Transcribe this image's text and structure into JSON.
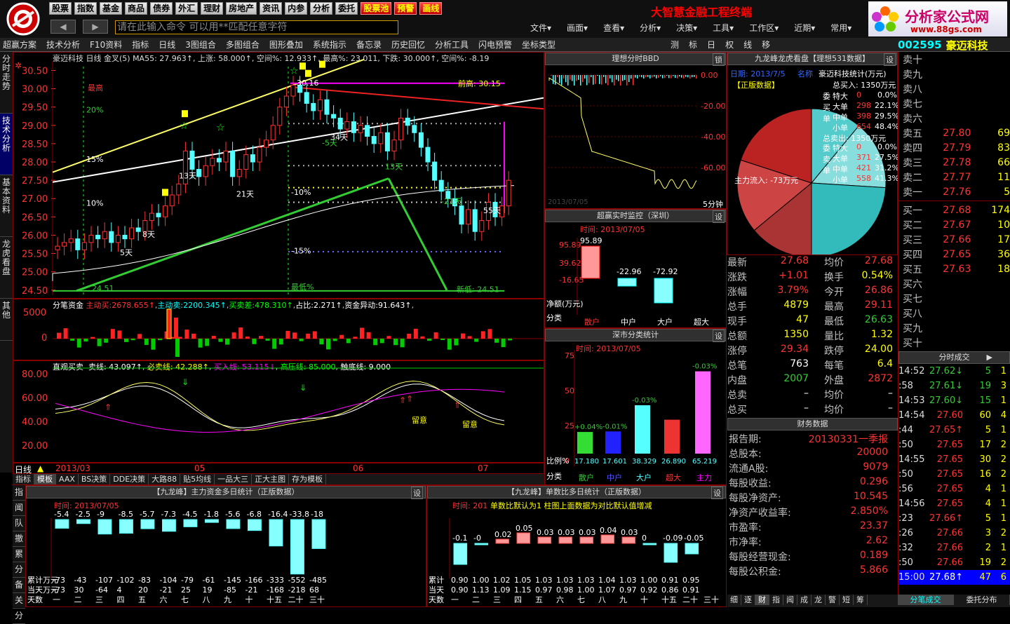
{
  "menubar": {
    "buttons": [
      "股票",
      "指数",
      "基金",
      "商品",
      "债券",
      "外汇",
      "理财",
      "房地产",
      "资讯",
      "内参",
      "分析",
      "委托"
    ],
    "red_buttons": [
      "股票池",
      "预警",
      "画线"
    ],
    "title": "大智慧金融工程终端",
    "cmd_placeholder": "请在此输入命令   可以用**匹配任意字符",
    "menus": [
      "文件▾",
      "画面▾",
      "查看▾",
      "分析▾",
      "决策▾",
      "工具▾",
      "工作区▾",
      "近期▾",
      "常用▾"
    ],
    "brand_name": "分析家公式网",
    "brand_url": "www.88gs.com"
  },
  "toolbar": [
    "超赢方案",
    "技术分析",
    "F10资料",
    "指标",
    "日线",
    "3图组合",
    "多图组合",
    "图形叠加",
    "系统指示",
    "备忘录",
    "历史回忆",
    "分析工具",
    "闪电预警",
    "坐标类型",
    "测",
    "标",
    "日",
    "权",
    "线",
    "移"
  ],
  "stock": {
    "code": "002595",
    "name": "豪迈科技"
  },
  "left_tabs": [
    "分时走势",
    "技术分析",
    "基本资料",
    "龙虎看盘",
    "其他"
  ],
  "main_info": "豪迈科技 日线 金叉(5) MA55: 27.963↑, 上涨: 58.000↑, 空间%: 12.933↑, 最高%: 23.011, 下跌: 30.000↑, 空间%: -8.19",
  "price_axis": [
    "30.50",
    "30.00",
    "29.50",
    "29.00",
    "28.50",
    "28.00",
    "27.50",
    "27.00",
    "26.50",
    "26.00",
    "25.50",
    "25.00",
    "24.50"
  ],
  "chart_labels": {
    "high": "最高",
    "high_price": "30.16",
    "prev_high": "前高: 30.15",
    "new_low": "新低: 24.51",
    "low_pct": "最低%",
    "low_price": "24.51",
    "pct_20": "20%",
    "pct_15": "15%",
    "pct_10": "10%",
    "pct_m10": "-10%",
    "pct_m15": "-15%",
    "d5": "5天",
    "d8": "8天",
    "d13": "13天",
    "d21": "21天",
    "d34": "34天",
    "d55": "55天",
    "dm5": "-5天",
    "dm21": "-21天",
    "d13b": "13天"
  },
  "sub1": {
    "title": "分笔资金",
    "zd_label": "主动买:",
    "zd": "2678.655↑",
    "zm_label": "主动卖:",
    "zm": "2200.345↑",
    "mc_label": "买卖差:",
    "mc": "478.310↑",
    "zb_label": "占比:",
    "zb": "2.271↑",
    "zj_label": "资金异动:",
    "zj": "91.643↑",
    "axis": [
      "5000",
      "0"
    ]
  },
  "sub2": {
    "title": "直观买卖",
    "m1": "卖线: 43.097↑",
    "m2": "必卖线: 42.288↑",
    "m3": "买入线: 53.115↓",
    "m4": "高压线: 85.000",
    "m5": "触底线: 9.000",
    "axis": [
      "80.00",
      "60.00",
      "40.00",
      "20.00"
    ],
    "note1": "留意",
    "note2": "留意"
  },
  "date_axis": {
    "period": "日线",
    "dates": [
      "2013/03",
      "05",
      "06",
      "07"
    ]
  },
  "bottom_tabs": [
    "指标",
    "模板",
    "AAX",
    "BS决策",
    "DDE决策",
    "大路88",
    "贴5均线",
    "一品大三",
    "正大主图",
    "存为模板"
  ],
  "bbd": {
    "title": "理想分时BBD",
    "lock": "锁",
    "axis": [
      "0.00",
      "-20.00",
      "-40.00",
      "-60.00"
    ],
    "date": "2013/07/05",
    "period": "5分钟"
  },
  "monitor": {
    "title": "超赢实时监控（深圳）",
    "set": "设",
    "time": "时间: 2013/07/05",
    "axis": [
      "95.89",
      "39.62",
      "-16.65"
    ],
    "vals": [
      "95.89",
      "-22.96",
      "-72.92"
    ],
    "unit": "净额(万元)",
    "cat_label": "分类",
    "cats": [
      "散户",
      "中户",
      "大户",
      "超大"
    ]
  },
  "classify": {
    "title": "深市分类统计",
    "set": "设",
    "time": "时间: 2013/07/05",
    "axis": [
      "75",
      "50",
      "25",
      "0"
    ],
    "top": [
      "+0.04%",
      "-0.01%",
      "-0.03%",
      "-0.03%"
    ],
    "vals": [
      "17.180",
      "17.601",
      "38.329",
      "26.890",
      "65.219"
    ],
    "unit": "比例%",
    "cat_label": "分类",
    "cats": [
      "散户",
      "中户",
      "大户",
      "超大",
      "主力"
    ]
  },
  "dragon": {
    "title": "九龙峰龙虎看盘【理想531数据】",
    "set": "设",
    "date": "日期: 2013/7/5",
    "name_label": "名称",
    "stat": "豪迈科技统计(万元)",
    "edition": "【正版数据】",
    "buy_total": "总买入: 1350万元",
    "sell_total": "总卖出: 1350万元",
    "net": "主力流入: -73万元",
    "buy_rows": [
      {
        "n": "特大",
        "v": "0",
        "p": "0.0%"
      },
      {
        "n": "大单",
        "v": "298",
        "p": "22.1%"
      },
      {
        "n": "中单",
        "v": "398",
        "p": "29.5%"
      },
      {
        "n": "小单",
        "v": "654",
        "p": "48.4%"
      }
    ],
    "sell_rows": [
      {
        "n": "特大",
        "v": "0",
        "p": "0.0%"
      },
      {
        "n": "大单",
        "v": "371",
        "p": "27.5%"
      },
      {
        "n": "中单",
        "v": "421",
        "p": "31.2%"
      },
      {
        "n": "小单",
        "v": "558",
        "p": "41.3%"
      }
    ],
    "side_buy": [
      "委",
      "买",
      "单"
    ],
    "side_sell": [
      "委",
      "卖",
      "单"
    ]
  },
  "info": [
    [
      "最新",
      "27.68",
      "均价",
      "27.68"
    ],
    [
      "涨跌",
      "+1.01",
      "换手",
      "0.54%"
    ],
    [
      "涨幅",
      "3.79%",
      "今开",
      "26.86"
    ],
    [
      "总手",
      "4879",
      "最高",
      "29.11"
    ],
    [
      "现手",
      "47",
      "最低",
      "26.63"
    ],
    [
      "总额",
      "1350",
      "量比",
      "1.32"
    ],
    [
      "涨停",
      "29.34",
      "跌停",
      "24.00"
    ],
    [
      "总笔",
      "763",
      "每笔",
      "6.4"
    ],
    [
      "内盘",
      "2007",
      "外盘",
      "2872"
    ],
    [
      "总卖",
      "–",
      "均价",
      "–"
    ],
    [
      "总买",
      "–",
      "均价",
      "–"
    ]
  ],
  "finance": {
    "title": "财务数据",
    "rows": [
      [
        "报告期:",
        "20130331一季报"
      ],
      [
        "总股本:",
        "20000"
      ],
      [
        "流通A股:",
        "9079"
      ],
      [
        "每股收益:",
        "0.296"
      ],
      [
        "每股净资产:",
        "10.545"
      ],
      [
        "净资产收益率:",
        "2.850%"
      ],
      [
        "市盈率:",
        "23.37"
      ],
      [
        "市净率:",
        "2.62"
      ],
      [
        "每股经营现金:",
        "0.189"
      ],
      [
        "每股公积金:",
        "5.866"
      ]
    ]
  },
  "quote": {
    "sell": [
      [
        "卖十",
        "",
        ""
      ],
      [
        "卖九",
        "",
        ""
      ],
      [
        "卖八",
        "",
        ""
      ],
      [
        "卖七",
        "",
        ""
      ],
      [
        "卖六",
        "",
        ""
      ],
      [
        "卖五",
        "27.80",
        "69"
      ],
      [
        "卖四",
        "27.79",
        "83"
      ],
      [
        "卖三",
        "27.78",
        "66"
      ],
      [
        "卖二",
        "27.77",
        "11"
      ],
      [
        "卖一",
        "27.76",
        "5"
      ]
    ],
    "buy": [
      [
        "买一",
        "27.68",
        "174"
      ],
      [
        "买二",
        "27.67",
        "10"
      ],
      [
        "买三",
        "27.66",
        "17"
      ],
      [
        "买四",
        "27.65",
        "36"
      ],
      [
        "买五",
        "27.63",
        "18"
      ],
      [
        "买六",
        "",
        ""
      ],
      [
        "买七",
        "",
        ""
      ],
      [
        "买八",
        "",
        ""
      ],
      [
        "买九",
        "",
        ""
      ],
      [
        "买十",
        "",
        ""
      ]
    ]
  },
  "ticks": {
    "title": "分时成交",
    "rows": [
      [
        "14:52",
        "27.62↓",
        "5",
        "1"
      ],
      [
        ":58",
        "27.61↓",
        "19",
        "3"
      ],
      [
        "14:53",
        "27.60↓",
        "15",
        "1"
      ],
      [
        "14:54",
        "27.60",
        "60",
        "4"
      ],
      [
        ":44",
        "27.65↑",
        "5",
        "1"
      ],
      [
        ":50",
        "27.65",
        "17",
        "2"
      ],
      [
        "14:55",
        "27.65",
        "30",
        "2"
      ],
      [
        ":50",
        "27.65",
        "16",
        "2"
      ],
      [
        ":56",
        "27.65",
        "4",
        "1"
      ],
      [
        "14:56",
        "27.65",
        "4",
        "1"
      ],
      [
        ":23",
        "27.66↑",
        "5",
        "1"
      ],
      [
        ":26",
        "27.66",
        "3",
        "2"
      ],
      [
        ":32",
        "27.66",
        "2",
        "1"
      ],
      [
        ":50",
        "27.66",
        "19",
        "2"
      ],
      [
        "15:00",
        "27.68↑",
        "47",
        "6"
      ]
    ]
  },
  "right_bottom_tabs": [
    "细",
    "逐",
    "财",
    "指",
    "闻",
    "成",
    "龙",
    "警",
    "短",
    "筹"
  ],
  "right_tab2": [
    "分笔成交",
    "委托分布"
  ],
  "bot_left_tabs": [
    "指",
    "闻",
    "队",
    "撤",
    "累",
    "分",
    "备",
    "关",
    "分"
  ],
  "mainfund": {
    "title": "【九龙峰】主力资金多日统计（正版数据）",
    "set": "设",
    "time": "时间: 2013/07/05",
    "top": [
      "-5.4",
      "-2.5",
      "-9",
      "-8.5",
      "-5.7",
      "-7.3",
      "-4.5",
      "-1.8",
      "-5.6",
      "-6.8",
      "-16.4",
      "-33.8",
      "-18"
    ],
    "cum_label": "累计万元",
    "cum": [
      "-73",
      "-43",
      "-107",
      "-102",
      "-83",
      "-104",
      "-79",
      "-61",
      "-145",
      "-166",
      "-333",
      "-552",
      "-485"
    ],
    "day_label": "当天万元",
    "day": [
      "-73",
      "30",
      "-64",
      "4",
      "20",
      "-21",
      "25",
      "19",
      "-85",
      "-21",
      "-168",
      "-218",
      "68"
    ],
    "days_label": "天数",
    "days": [
      "一",
      "二",
      "三",
      "四",
      "五",
      "六",
      "七",
      "八",
      "九",
      "十",
      "十五",
      "二十",
      "三十"
    ]
  },
  "countratio": {
    "title": "【九龙峰】单数比多日统计（正版数据）",
    "set": "设",
    "time": "时间: 201",
    "note": "单数比默认为1 柱图上面数据为对比默认值增减",
    "top": [
      "-0.1",
      "-0",
      "0.02",
      "0.05",
      "0.03",
      "0.03",
      "0.03",
      "0.04",
      "0.03",
      "0",
      "-0.09",
      "-0.05"
    ],
    "cum_label": "累计",
    "cum": [
      "0.90",
      "1.00",
      "1.02",
      "1.05",
      "1.03",
      "1.03",
      "1.03",
      "1.04",
      "1.03",
      "1.00",
      "0.91",
      "0.95"
    ],
    "day_label": "当天",
    "day": [
      "0.90",
      "1.13",
      "1.09",
      "1.15",
      "0.97",
      "0.98",
      "1.00",
      "1.07",
      "0.97",
      "0.92",
      "0.86",
      "0.91"
    ],
    "days_label": "天数",
    "days": [
      "一",
      "二",
      "三",
      "四",
      "五",
      "六",
      "七",
      "八",
      "九",
      "十",
      "十五",
      "二十",
      "三十"
    ]
  }
}
